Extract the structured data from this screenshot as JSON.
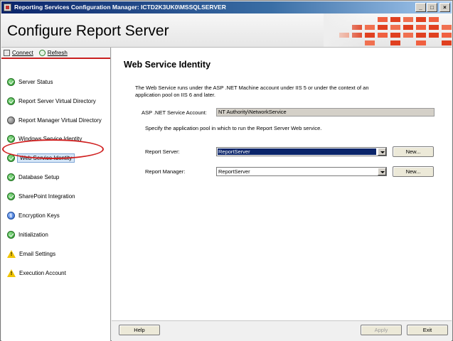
{
  "window": {
    "title": "Reporting Services Configuration Manager: ICTD2K3UK0\\MSSQLSERVER",
    "minimize_glyph": "_",
    "maximize_glyph": "□",
    "close_glyph": "×"
  },
  "header": {
    "title": "Configure Report Server"
  },
  "toolbar": {
    "connect_label": "Connect",
    "refresh_label": "Refresh"
  },
  "sidebar": {
    "items": [
      {
        "label": "Server Status",
        "status": "ok"
      },
      {
        "label": "Report Server Virtual Directory",
        "status": "ok"
      },
      {
        "label": "Report Manager Virtual Directory",
        "status": "gray"
      },
      {
        "label": "Windows Service Identity",
        "status": "ok"
      },
      {
        "label": "Web Service Identity",
        "status": "ok",
        "selected": true
      },
      {
        "label": "Database Setup",
        "status": "ok"
      },
      {
        "label": "SharePoint Integration",
        "status": "ok"
      },
      {
        "label": "Encryption Keys",
        "status": "info"
      },
      {
        "label": "Initialization",
        "status": "ok"
      },
      {
        "label": "Email Settings",
        "status": "warning"
      },
      {
        "label": "Execution Account",
        "status": "warning"
      }
    ]
  },
  "main": {
    "heading": "Web Service Identity",
    "description": "The Web Service runs under the ASP .NET Machine account under IIS 5 or under the context of an application pool on IIS 6 and later.",
    "service_account_label": "ASP .NET Service Account:",
    "service_account_value": "NT Authority\\NetworkService",
    "pool_prompt": "Specify the application pool in which to run the Report Server Web service.",
    "report_server_label": "Report Server:",
    "report_server_value": "ReportServer",
    "report_server_new": "New...",
    "report_manager_label": "Report Manager:",
    "report_manager_value": "ReportServer",
    "report_manager_new": "New..."
  },
  "footer": {
    "help_label": "Help",
    "apply_label": "Apply",
    "exit_label": "Exit"
  },
  "colors": {
    "title_bar": "#0a246a",
    "accent_red": "#c92020",
    "selection": "#0a246a",
    "status_ok": "#2e9a2e",
    "status_warning": "#f0c400",
    "status_info": "#2a62c8"
  }
}
